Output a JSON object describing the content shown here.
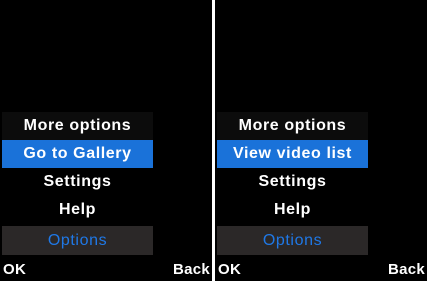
{
  "screens": [
    {
      "menu": {
        "title": "More options",
        "items": [
          {
            "label": "Go to Gallery",
            "selected": true
          },
          {
            "label": "Settings",
            "selected": false
          },
          {
            "label": "Help",
            "selected": false
          }
        ],
        "options_label": "Options"
      },
      "softkeys": {
        "left": "OK",
        "right": "Back"
      }
    },
    {
      "menu": {
        "title": "More options",
        "items": [
          {
            "label": "View video list",
            "selected": true
          },
          {
            "label": "Settings",
            "selected": false
          },
          {
            "label": "Help",
            "selected": false
          }
        ],
        "options_label": "Options"
      },
      "softkeys": {
        "left": "OK",
        "right": "Back"
      }
    }
  ],
  "colors": {
    "background": "#000000",
    "selection": "#1a72d9",
    "options_text": "#1f78e6",
    "options_bar": "#2b2828"
  }
}
